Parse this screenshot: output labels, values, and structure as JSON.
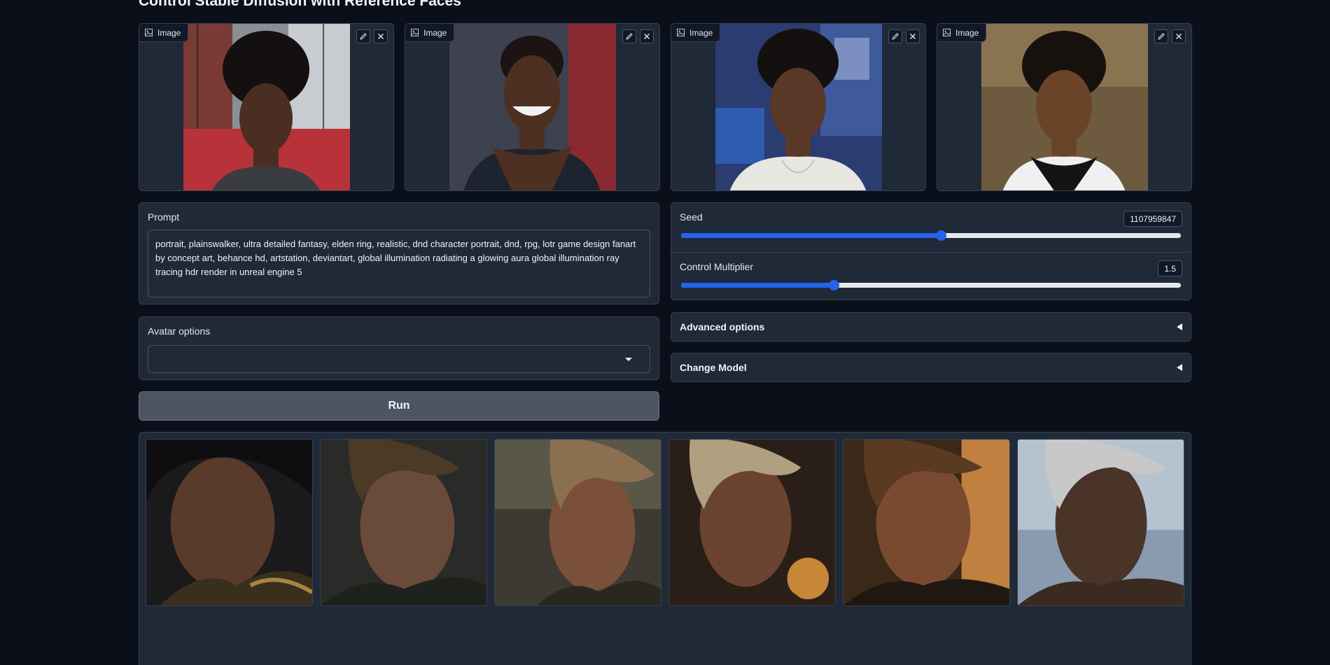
{
  "page": {
    "title": "Control Stable Diffusion with Reference Faces"
  },
  "input_images": [
    {
      "label": "Image"
    },
    {
      "label": "Image"
    },
    {
      "label": "Image"
    },
    {
      "label": "Image"
    }
  ],
  "prompt": {
    "label": "Prompt",
    "value": "portrait, plainswalker, ultra detailed fantasy, elden ring, realistic, dnd character portrait, dnd, rpg, lotr game design fanart by concept art, behance hd, artstation, deviantart, global illumination radiating a glowing aura global illumination ray tracing hdr render in unreal engine 5"
  },
  "avatar_options": {
    "label": "Avatar options",
    "selected": ""
  },
  "run_button": {
    "label": "Run"
  },
  "seed": {
    "label": "Seed",
    "value": "1107959847",
    "fraction": 0.52
  },
  "control_multiplier": {
    "label": "Control Multiplier",
    "value": "1.5",
    "fraction": 0.305
  },
  "advanced_options": {
    "label": "Advanced options"
  },
  "change_model": {
    "label": "Change Model"
  },
  "gallery": {
    "count": 6
  },
  "colors": {
    "background": "#0b0f19",
    "panel": "#1f2937",
    "border": "#374151",
    "accent": "#2563eb",
    "button": "#4b5563"
  }
}
